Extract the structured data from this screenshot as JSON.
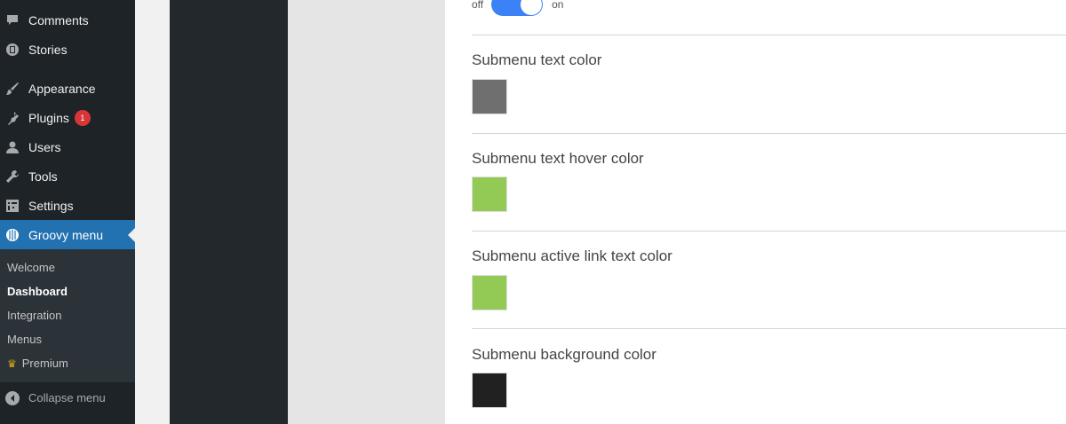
{
  "sidebar": {
    "items": [
      {
        "label": "Comments",
        "icon": "comment-icon"
      },
      {
        "label": "Stories",
        "icon": "stories-icon"
      },
      {
        "label": "Appearance",
        "icon": "brush-icon"
      },
      {
        "label": "Plugins",
        "icon": "plugin-icon",
        "badge": "1"
      },
      {
        "label": "Users",
        "icon": "user-icon"
      },
      {
        "label": "Tools",
        "icon": "wrench-icon"
      },
      {
        "label": "Settings",
        "icon": "settings-icon"
      },
      {
        "label": "Groovy menu",
        "icon": "groovy-icon",
        "current": true
      }
    ],
    "submenu": [
      {
        "label": "Welcome"
      },
      {
        "label": "Dashboard",
        "active": true
      },
      {
        "label": "Integration"
      },
      {
        "label": "Menus"
      },
      {
        "label": "Premium",
        "icon": "crown-icon"
      }
    ],
    "collapse_label": "Collapse menu"
  },
  "toggle": {
    "off_label": "off",
    "on_label": "on",
    "state": "on"
  },
  "options": [
    {
      "label": "Submenu text color",
      "color": "#6f6f6f"
    },
    {
      "label": "Submenu text hover color",
      "color": "#93c955"
    },
    {
      "label": "Submenu active link text color",
      "color": "#93c955"
    },
    {
      "label": "Submenu background color",
      "color": "#212121"
    }
  ]
}
